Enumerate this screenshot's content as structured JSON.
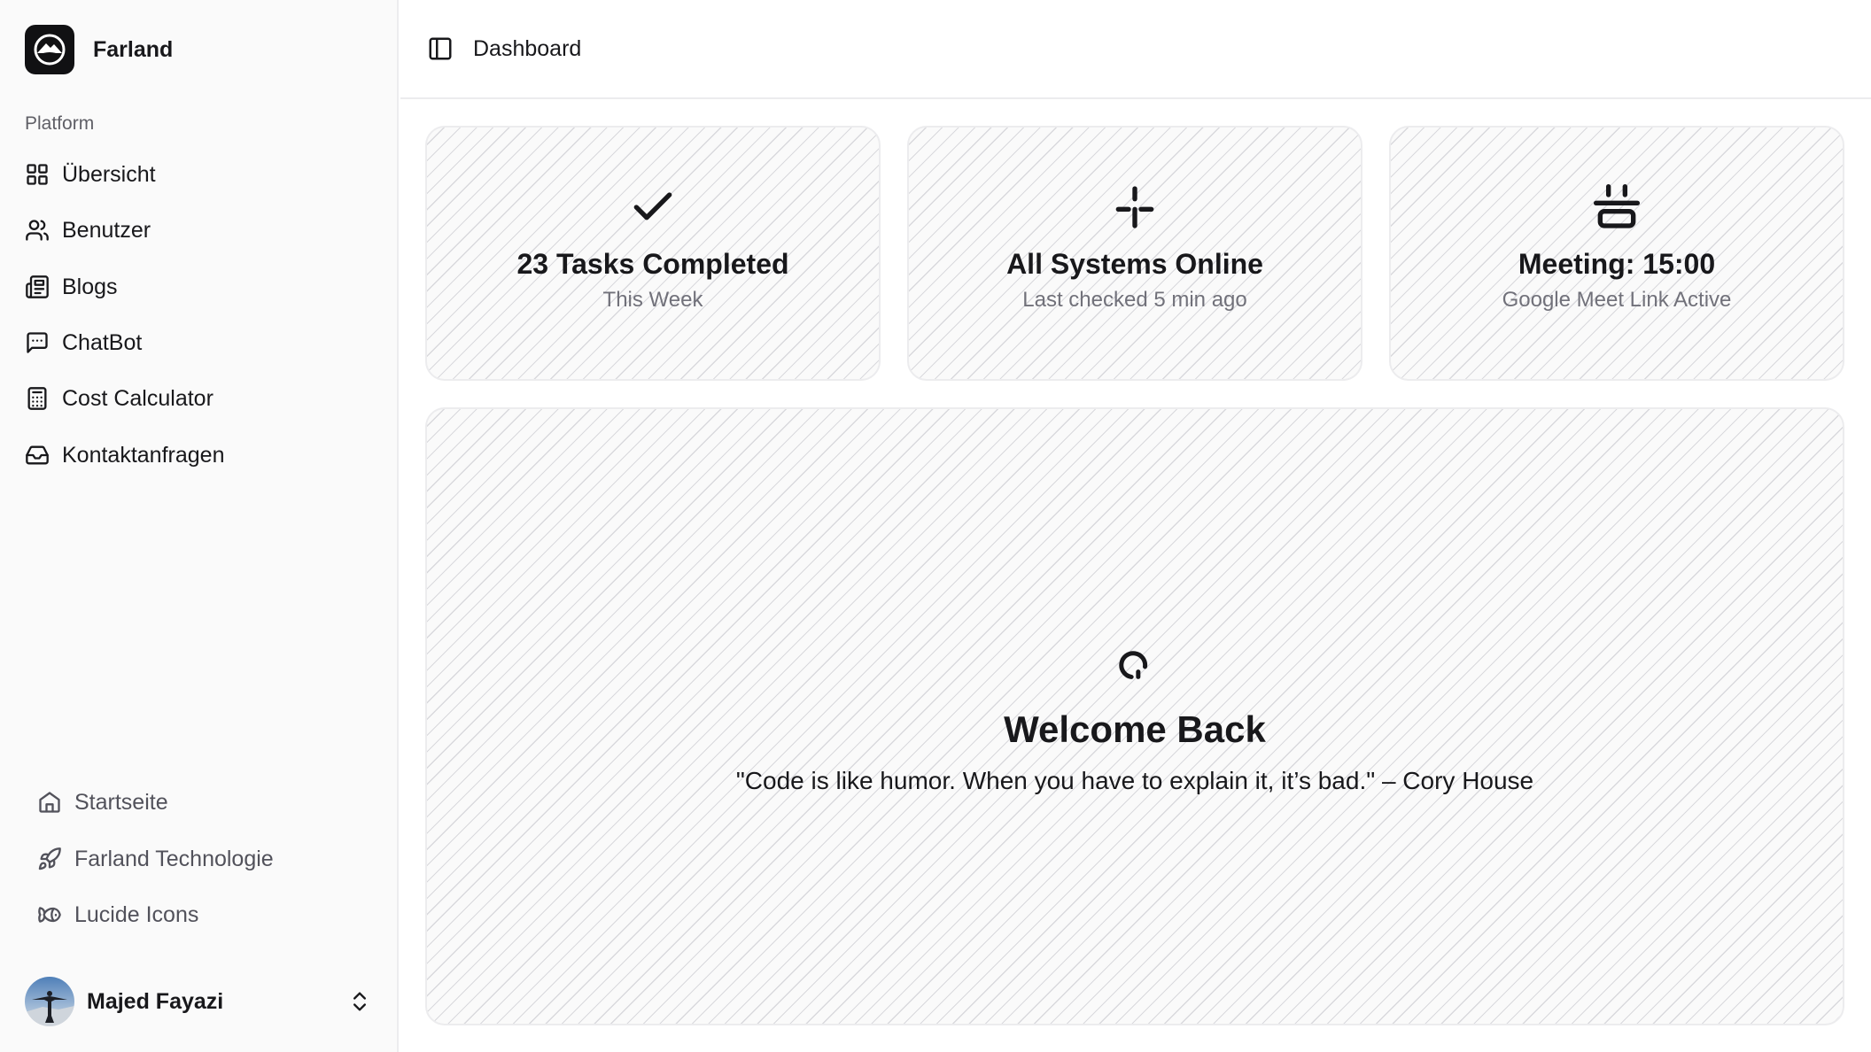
{
  "brand": {
    "name": "Farland"
  },
  "sidebar": {
    "group_label": "Platform",
    "items": [
      {
        "label": "Übersicht",
        "icon": "layout-grid-icon"
      },
      {
        "label": "Benutzer",
        "icon": "users-icon"
      },
      {
        "label": "Blogs",
        "icon": "newspaper-icon"
      },
      {
        "label": "ChatBot",
        "icon": "message-square-icon"
      },
      {
        "label": "Cost Calculator",
        "icon": "calculator-icon"
      },
      {
        "label": "Kontaktanfragen",
        "icon": "inbox-icon"
      }
    ],
    "secondary": [
      {
        "label": "Startseite",
        "icon": "home-icon"
      },
      {
        "label": "Farland Technologie",
        "icon": "rocket-icon"
      },
      {
        "label": "Lucide Icons",
        "icon": "fish-icon"
      }
    ],
    "user": {
      "name": "Majed Fayazi"
    }
  },
  "header": {
    "title": "Dashboard"
  },
  "cards": [
    {
      "title": "23 Tasks Completed",
      "subtitle": "This Week",
      "icon": "check-icon"
    },
    {
      "title": "All Systems Online",
      "subtitle": "Last checked 5 min ago",
      "icon": "split-icon"
    },
    {
      "title": "Meeting: 15:00",
      "subtitle": "Google Meet Link Active",
      "icon": "cooking-pot-icon"
    }
  ],
  "welcome": {
    "title": "Welcome Back",
    "quote": "\"Code is like humor. When you have to explain it, it’s bad.\" – Cory House",
    "icon": "loader-icon"
  },
  "colors": {
    "text": "#18181b",
    "muted": "#71717a",
    "sidebar_bg": "#fafafa",
    "border": "#ececee",
    "logo_bg": "#111113"
  }
}
